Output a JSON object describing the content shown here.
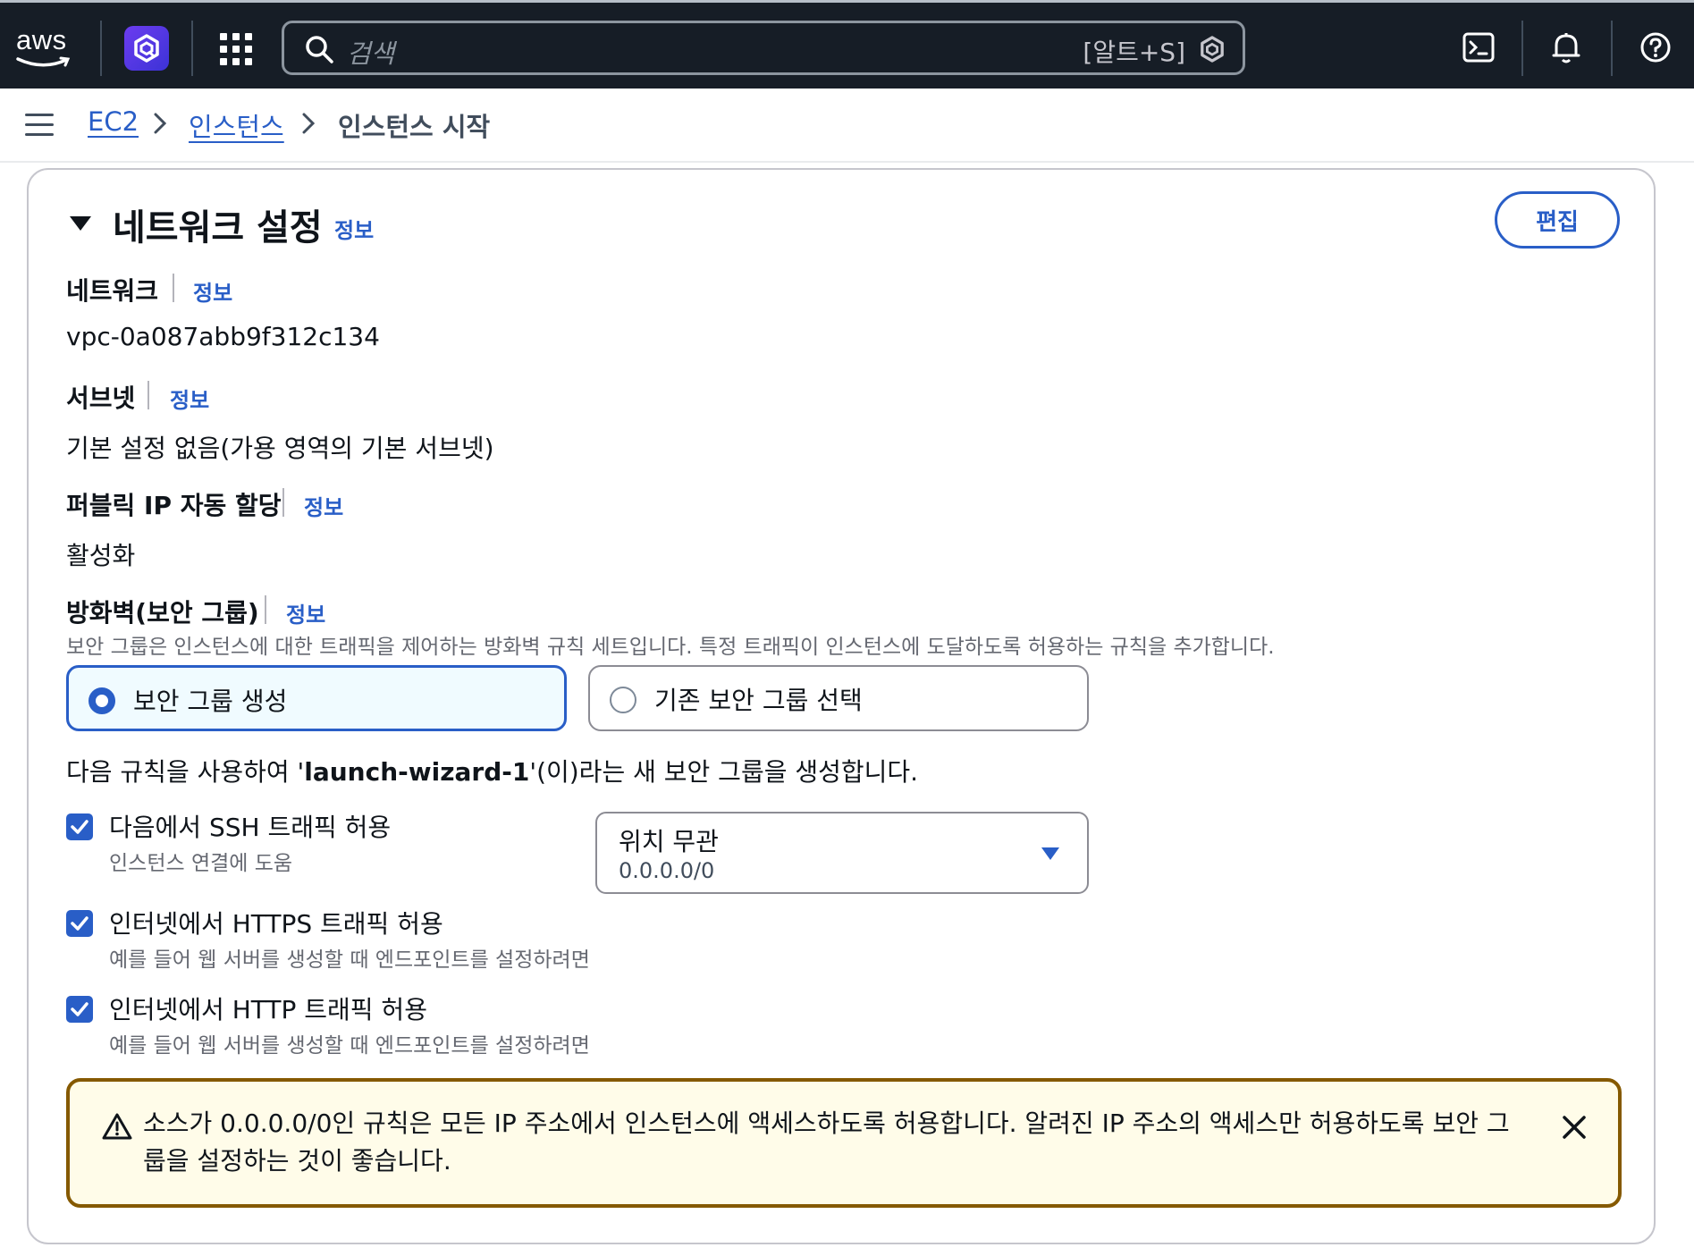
{
  "header": {
    "logo_text": "aws",
    "search_placeholder": "검색",
    "search_shortcut": "[알트+S]"
  },
  "breadcrumb": {
    "items": [
      "EC2",
      "인스턴스",
      "인스턴스 시작"
    ]
  },
  "section": {
    "title": "네트워크 설정",
    "info": "정보",
    "edit_label": "편집"
  },
  "fields": {
    "network": {
      "label": "네트워크",
      "info": "정보",
      "value": "vpc-0a087abb9f312c134"
    },
    "subnet": {
      "label": "서브넷",
      "info": "정보",
      "value": "기본 설정 없음(가용 영역의 기본 서브넷)"
    },
    "public_ip": {
      "label": "퍼블릭 IP 자동 할당",
      "info": "정보",
      "value": "활성화"
    },
    "firewall": {
      "label": "방화벽(보안 그룹)",
      "info": "정보",
      "description": "보안 그룹은 인스턴스에 대한 트래픽을 제어하는 방화벽 규칙 세트입니다. 특정 트래픽이 인스턴스에 도달하도록 허용하는 규칙을 추가합니다."
    }
  },
  "options": {
    "create": {
      "label": "보안 그룹 생성",
      "selected": true
    },
    "existing": {
      "label": "기존 보안 그룹 선택",
      "selected": false
    }
  },
  "rule_sentence": {
    "prefix": "다음 규칙을 사용하여 '",
    "name": "launch-wizard-1",
    "suffix": "'(이)라는 새 보안 그룹을 생성합니다."
  },
  "rules": [
    {
      "label": "다음에서 SSH 트래픽 허용",
      "desc": "인스턴스 연결에 도움",
      "checked": true
    },
    {
      "label": "인터넷에서 HTTPS 트래픽 허용",
      "desc": "예를 들어 웹 서버를 생성할 때 엔드포인트를 설정하려면",
      "checked": true
    },
    {
      "label": "인터넷에서 HTTP 트래픽 허용",
      "desc": "예를 들어 웹 서버를 생성할 때 엔드포인트를 설정하려면",
      "checked": true
    }
  ],
  "ssh_source": {
    "value": "위치 무관",
    "sub": "0.0.0.0/0"
  },
  "warning": {
    "text": "소스가 0.0.0.0/0인 규칙은 모든 IP 주소에서 인스턴스에 액세스하도록 허용합니다. 알려진 IP 주소의 액세스만 허용하도록 보안 그룹을 설정하는 것이 좋습니다."
  },
  "colors": {
    "topbar": "#161d26",
    "link": "#295ec7",
    "warning_border": "#855900",
    "warning_bg": "#fffce9"
  }
}
